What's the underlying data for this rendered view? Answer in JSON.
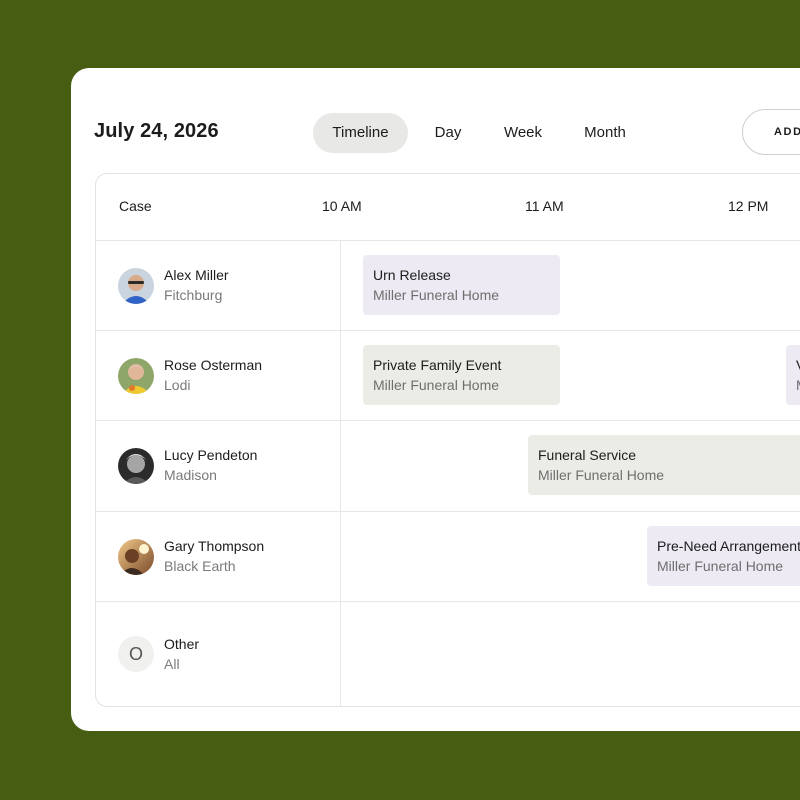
{
  "header": {
    "date": "July 24, 2026",
    "tabs": [
      {
        "label": "Timeline",
        "active": true
      },
      {
        "label": "Day",
        "active": false
      },
      {
        "label": "Week",
        "active": false
      },
      {
        "label": "Month",
        "active": false
      }
    ],
    "add_label": "ADD"
  },
  "grid": {
    "case_header": "Case",
    "times": [
      "10 AM",
      "11 AM",
      "12 PM"
    ],
    "rows": [
      {
        "name": "Alex Miller",
        "location": "Fitchburg",
        "avatar": "person-photo"
      },
      {
        "name": "Rose Osterman",
        "location": "Lodi",
        "avatar": "person-photo"
      },
      {
        "name": "Lucy Pendeton",
        "location": "Madison",
        "avatar": "person-photo"
      },
      {
        "name": "Gary Thompson",
        "location": "Black Earth",
        "avatar": "person-photo"
      },
      {
        "name": "Other",
        "location": "All",
        "avatar_letter": "O"
      }
    ],
    "events": [
      {
        "title": "Urn Release",
        "subtitle": "Miller Funeral Home",
        "color": "#edeaf3"
      },
      {
        "title": "Private Family Event",
        "subtitle": "Miller Funeral Home",
        "color": "#ecece6"
      },
      {
        "title": "V",
        "subtitle": "M",
        "color": "#edeaf3"
      },
      {
        "title": "Funeral Service",
        "subtitle": "Miller Funeral Home",
        "color": "#ecece6"
      },
      {
        "title": "Pre-Need Arrangement",
        "subtitle": "Miller Funeral Home",
        "color": "#edeaf3"
      }
    ]
  },
  "colors": {
    "background": "#475d12",
    "active_tab": "#e8e8e6",
    "event_purple": "#edeaf3",
    "event_gray": "#ecece6"
  }
}
